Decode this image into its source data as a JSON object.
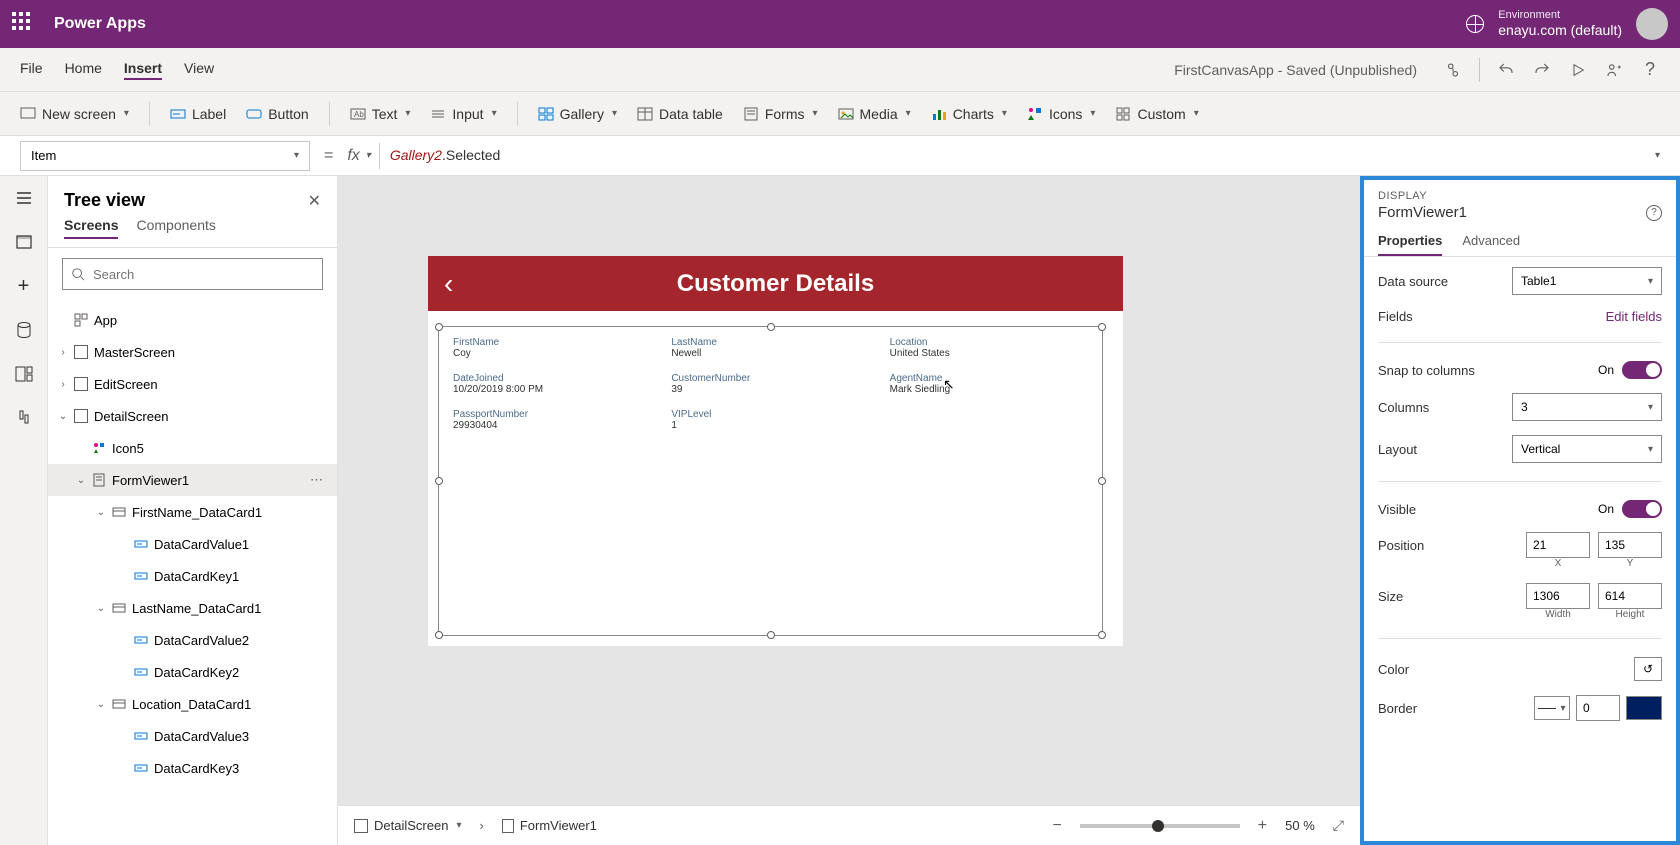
{
  "topbar": {
    "title": "Power Apps",
    "env_label": "Environment",
    "env_name": "enayu.com (default)"
  },
  "menubar": {
    "items": [
      "File",
      "Home",
      "Insert",
      "View"
    ],
    "active_index": 2,
    "status": "FirstCanvasApp - Saved (Unpublished)"
  },
  "ribbon": {
    "new_screen": "New screen",
    "label": "Label",
    "button": "Button",
    "text": "Text",
    "input": "Input",
    "gallery": "Gallery",
    "data_table": "Data table",
    "forms": "Forms",
    "media": "Media",
    "charts": "Charts",
    "icons": "Icons",
    "custom": "Custom"
  },
  "formulabar": {
    "property": "Item",
    "formula_obj": "Gallery2",
    "formula_rest": ".Selected"
  },
  "treeview": {
    "title": "Tree view",
    "tabs": [
      "Screens",
      "Components"
    ],
    "active_tab": 0,
    "search_placeholder": "Search",
    "items": {
      "app": "App",
      "master": "MasterScreen",
      "edit": "EditScreen",
      "detail": "DetailScreen",
      "icon5": "Icon5",
      "formviewer": "FormViewer1",
      "fn_card": "FirstName_DataCard1",
      "dcv1": "DataCardValue1",
      "dck1": "DataCardKey1",
      "ln_card": "LastName_DataCard1",
      "dcv2": "DataCardValue2",
      "dck2": "DataCardKey2",
      "loc_card": "Location_DataCard1",
      "dcv3": "DataCardValue3",
      "dck3": "DataCardKey3"
    }
  },
  "canvas": {
    "header_title": "Customer Details",
    "fields": [
      {
        "label": "FirstName",
        "value": "Coy"
      },
      {
        "label": "LastName",
        "value": "Newell"
      },
      {
        "label": "Location",
        "value": "United States"
      },
      {
        "label": "DateJoined",
        "value": "10/20/2019 8:00 PM"
      },
      {
        "label": "CustomerNumber",
        "value": "39"
      },
      {
        "label": "AgentName",
        "value": "Mark Siedling"
      },
      {
        "label": "PassportNumber",
        "value": "29930404"
      },
      {
        "label": "VIPLevel",
        "value": "1"
      }
    ]
  },
  "properties": {
    "section": "DISPLAY",
    "element": "FormViewer1",
    "tabs": [
      "Properties",
      "Advanced"
    ],
    "active_tab": 0,
    "data_source_label": "Data source",
    "data_source_value": "Table1",
    "fields_label": "Fields",
    "edit_fields": "Edit fields",
    "snap_label": "Snap to columns",
    "snap_value": "On",
    "columns_label": "Columns",
    "columns_value": "3",
    "layout_label": "Layout",
    "layout_value": "Vertical",
    "visible_label": "Visible",
    "visible_value": "On",
    "position_label": "Position",
    "pos_x": "21",
    "pos_y": "135",
    "x_label": "X",
    "y_label": "Y",
    "size_label": "Size",
    "width": "1306",
    "height": "614",
    "width_label": "Width",
    "height_label": "Height",
    "color_label": "Color",
    "border_label": "Border",
    "border_width": "0"
  },
  "statusbar": {
    "crumb1": "DetailScreen",
    "crumb2": "FormViewer1",
    "zoom": "50",
    "zoom_suffix": "%"
  }
}
